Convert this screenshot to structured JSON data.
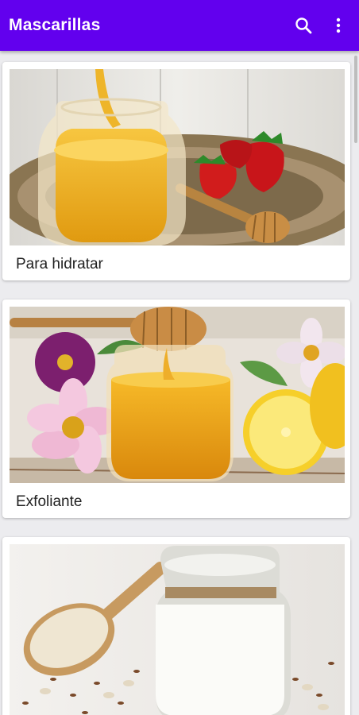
{
  "appbar": {
    "title": "Mascarillas",
    "search_icon": "search-icon",
    "more_icon": "more-vert-icon",
    "color": "#6200ee"
  },
  "cards": [
    {
      "label": "Para hidratar",
      "image": "honey-jar-with-strawberries-and-dipper"
    },
    {
      "label": "Exfoliante",
      "image": "honey-jar-with-flowers-and-lemon"
    },
    {
      "label": "",
      "image": "yogurt-jar-with-oats-and-spoon"
    }
  ]
}
